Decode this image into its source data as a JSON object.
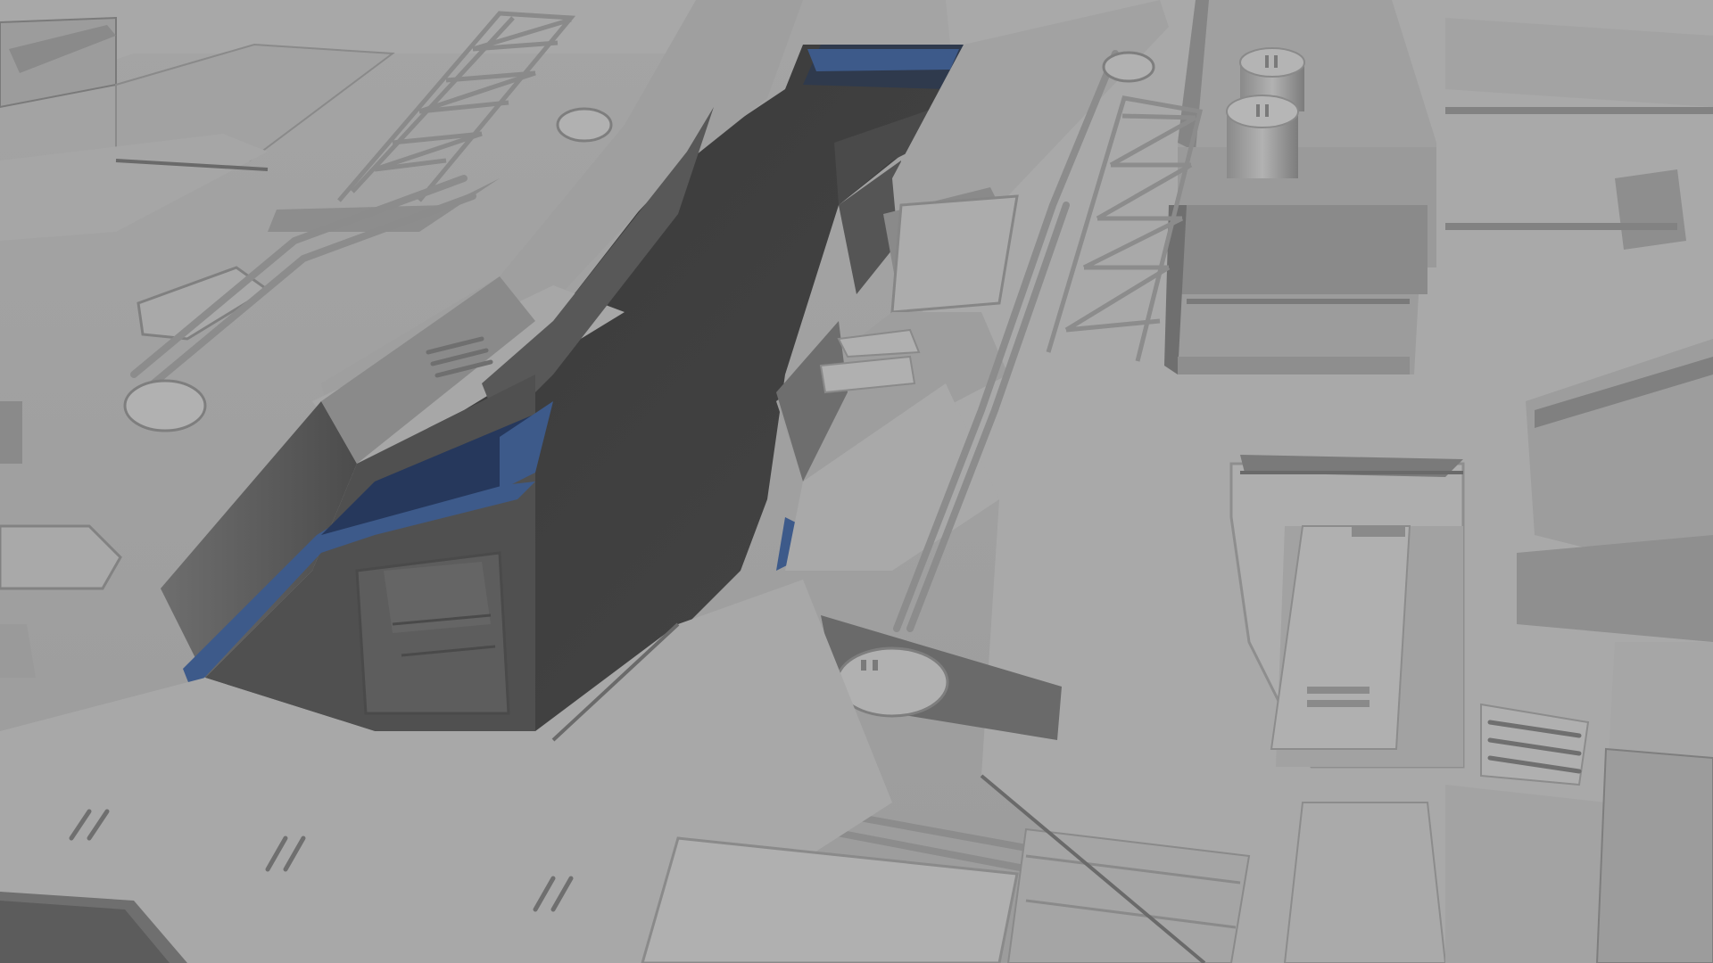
{
  "viewport": {
    "content": "3d-render",
    "shading": "flat-grey-clay",
    "visible_text": []
  },
  "colors": {
    "surface_light": "#a9a9a9",
    "surface_mid": "#9a9a9a",
    "surface_dark": "#7d7d7d",
    "shadow": "#555555",
    "trench": "#3c3c3c",
    "trench_deep": "#333333",
    "glass_blue": "#3d5a8a",
    "glass_blue_dark": "#26385c"
  },
  "objects": [
    "deck-plating",
    "trench",
    "left-wall-block",
    "right-ledge",
    "tower-structure",
    "twin-tanks",
    "truss-bridge-left",
    "truss-bridge-right",
    "pipe-runs",
    "circular-hatch",
    "vent-grilles",
    "blue-glass-windows"
  ]
}
